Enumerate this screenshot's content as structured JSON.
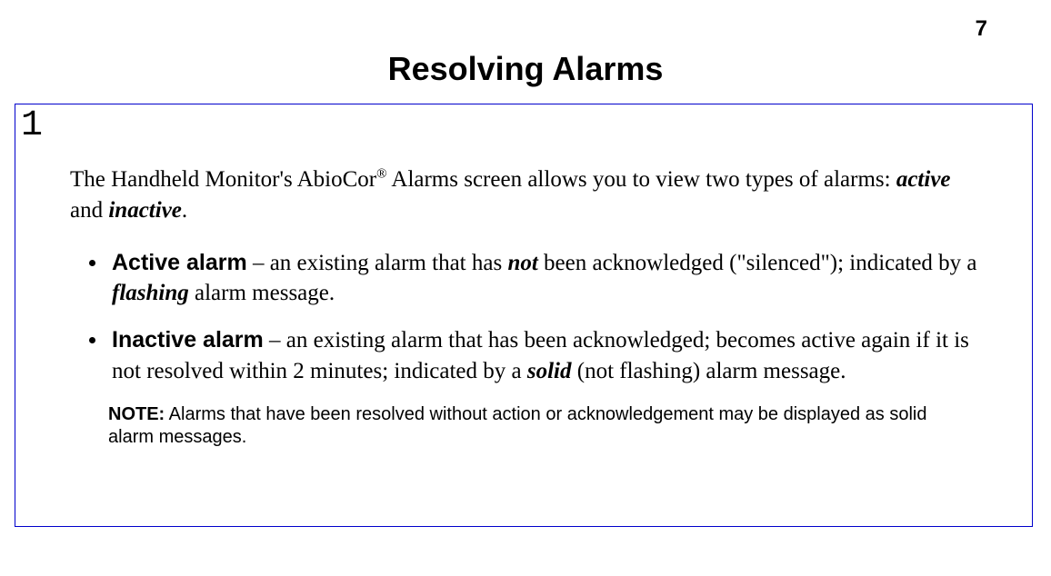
{
  "header": {
    "page_number": "7",
    "title": "Resolving Alarms"
  },
  "section": {
    "number": "1",
    "intro_prefix": "The Handheld Monitor's AbioCor",
    "intro_sup": "®",
    "intro_mid": " Alarms screen allows you to view two types of alarms: ",
    "intro_active": "active",
    "intro_and": " and ",
    "intro_inactive": "inactive",
    "intro_period": "."
  },
  "bullets": {
    "active": {
      "term": "Active alarm",
      "dash_prefix": " – an existing alarm that has ",
      "not": "not",
      "after_not": " been acknowledged (\"silenced\"); indicated by a ",
      "flashing": "flashing",
      "after_flashing": " alarm message."
    },
    "inactive": {
      "term": "Inactive alarm",
      "dash_prefix": " – an existing alarm that has been acknowledged; becomes active again if it is not resolved within 2 minutes; indicated by a ",
      "solid": "solid",
      "after_solid": " (not flashing) alarm message."
    }
  },
  "note": {
    "label": "NOTE:",
    "text": "  Alarms that have been resolved without action or acknowledgement may be displayed as solid alarm messages."
  }
}
